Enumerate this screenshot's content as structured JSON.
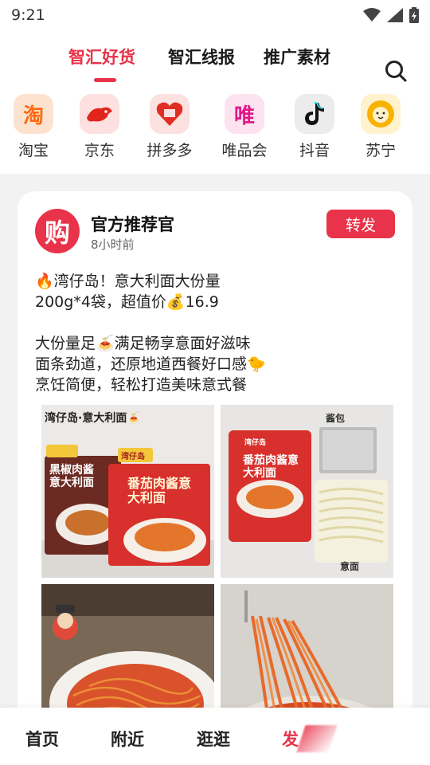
{
  "status": {
    "time": "9:21",
    "icons": [
      "wifi-icon",
      "signal-icon",
      "battery-icon"
    ]
  },
  "tabs": [
    {
      "label": "智汇好货",
      "active": true
    },
    {
      "label": "智汇线报",
      "active": false
    },
    {
      "label": "推广素材",
      "active": false
    }
  ],
  "platforms": [
    {
      "label": "淘宝",
      "glyph": "淘"
    },
    {
      "label": "京东",
      "glyph": ""
    },
    {
      "label": "拼多多",
      "glyph": ""
    },
    {
      "label": "唯品会",
      "glyph": "唯"
    },
    {
      "label": "抖音",
      "glyph": ""
    },
    {
      "label": "苏宁",
      "glyph": ""
    }
  ],
  "post": {
    "avatar_glyph": "购",
    "author": "官方推荐官",
    "time": "8小时前",
    "share_label": "转发",
    "lines": [
      "🔥湾仔岛！意大利面大份量",
      "200g*4袋，超值价💰16.9",
      "",
      "大份量足🍝满足畅享意面好滋味",
      "面条劲道，还原地道西餐好口感🐤",
      "烹饪简便，轻松打造美味意式餐"
    ],
    "images": [
      {
        "caption": "湾仔岛·意大利面🍝",
        "pkg1": "黑椒肉酱意大利面",
        "pkg2": "番茄肉酱意大利面",
        "brand": "湾仔岛"
      },
      {
        "pkg": "番茄肉酱意大利面",
        "brand": "湾仔岛",
        "tag1": "酱包",
        "tag2": "意面"
      },
      {
        "kind": "plate"
      },
      {
        "kind": "fork"
      }
    ]
  },
  "bottom_nav": [
    {
      "label": "首页",
      "active": false
    },
    {
      "label": "附近",
      "active": false
    },
    {
      "label": "逛逛",
      "active": false
    },
    {
      "label": "发",
      "active": true
    }
  ],
  "colors": {
    "accent": "#e8334a"
  }
}
